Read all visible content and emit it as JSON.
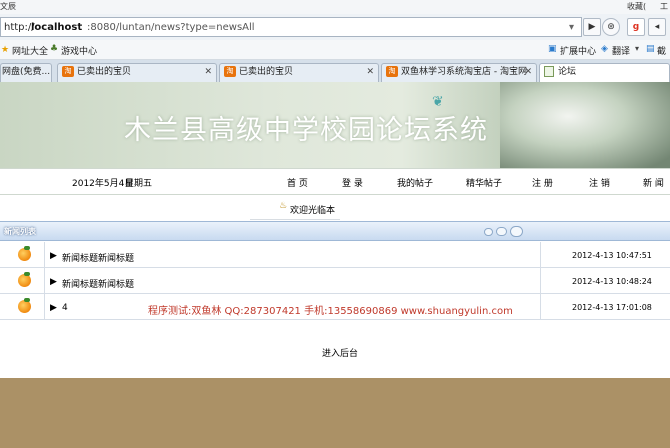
{
  "browser": {
    "top_left": "文辰",
    "top_right_1": "收藏(",
    "top_right_2": "工",
    "url": "http://localhost:8080/luntan/news?type=newsAll",
    "url_host": "localhost",
    "url_rest": ":8080/luntan/news?type=newsAll",
    "favorites": [
      "网址大全",
      "游戏中心"
    ],
    "toolbar_right": [
      "扩展中心",
      "翻译",
      "截"
    ],
    "tabs": [
      {
        "label": "网盘(免费..."
      },
      {
        "label": "已卖出的宝贝"
      },
      {
        "label": "已卖出的宝贝"
      },
      {
        "label": "双鱼林学习系统淘宝店 - 淘宝网"
      },
      {
        "label": "论坛"
      }
    ],
    "tab_icon_text": "淘"
  },
  "site": {
    "title": "木兰县高级中学校园论坛系统",
    "date": "2012年5月4日",
    "weekday": "星期五",
    "nav": [
      "首 页",
      "登 录",
      "我的帖子",
      "精华帖子",
      "注 册",
      "注 销",
      "新 闻"
    ],
    "welcome": "欢迎光临本"
  },
  "news": {
    "header": "新闻列表",
    "items": [
      {
        "title": "新闻标题新闻标题",
        "time": "2012-4-13 10:47:51"
      },
      {
        "title": "新闻标题新闻标题",
        "time": "2012-4-13 10:48:24"
      },
      {
        "title": "4",
        "time": "2012-4-13 17:01:08"
      }
    ],
    "watermark": "程序测试:双鱼林 QQ:287307421 手机:13558690869 www.shuangyulin.com",
    "watermark_color": "#c0392b"
  },
  "admin_link": "进入后台"
}
